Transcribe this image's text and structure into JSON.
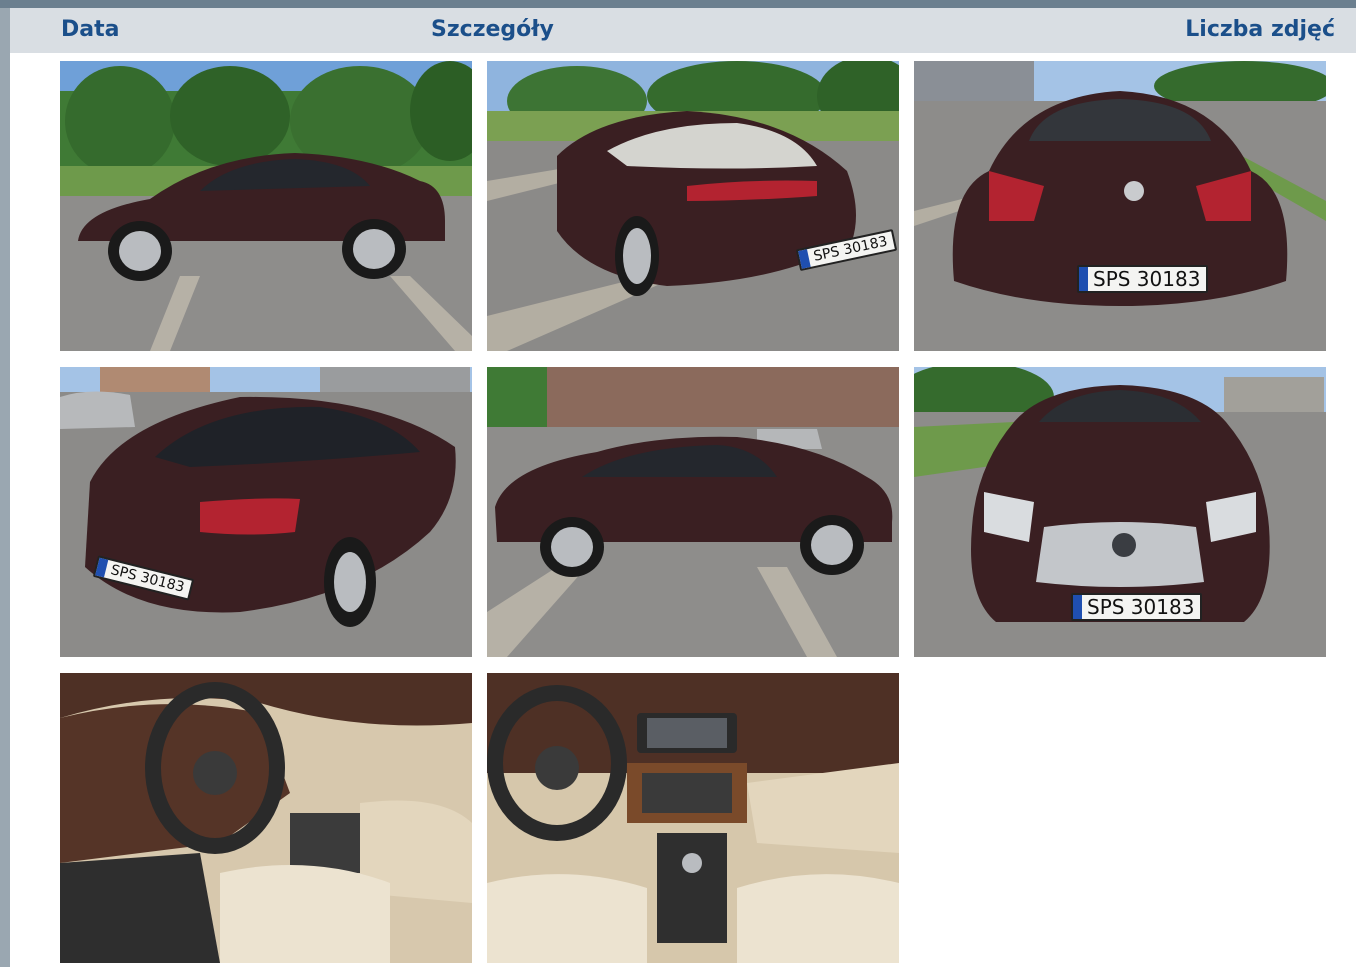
{
  "table_header": {
    "date_label": "Data",
    "details_label": "Szczegóły",
    "photo_count_label": "Liczba zdjęć"
  },
  "photos": [
    {
      "view": "side-left",
      "plate": ""
    },
    {
      "view": "rear-three-quarter",
      "plate": "SPS 30183"
    },
    {
      "view": "rear",
      "plate": "SPS 30183"
    },
    {
      "view": "rear-three-quarter-right",
      "plate": "SPS 30183"
    },
    {
      "view": "side-right",
      "plate": ""
    },
    {
      "view": "front",
      "plate": "SPS 30183"
    },
    {
      "view": "interior-driver",
      "plate": ""
    },
    {
      "view": "interior-dashboard",
      "plate": ""
    }
  ],
  "colors": {
    "header_text": "#1b4f8a",
    "header_bg": "#d9dee3",
    "car_paint": "#3a1f22"
  }
}
